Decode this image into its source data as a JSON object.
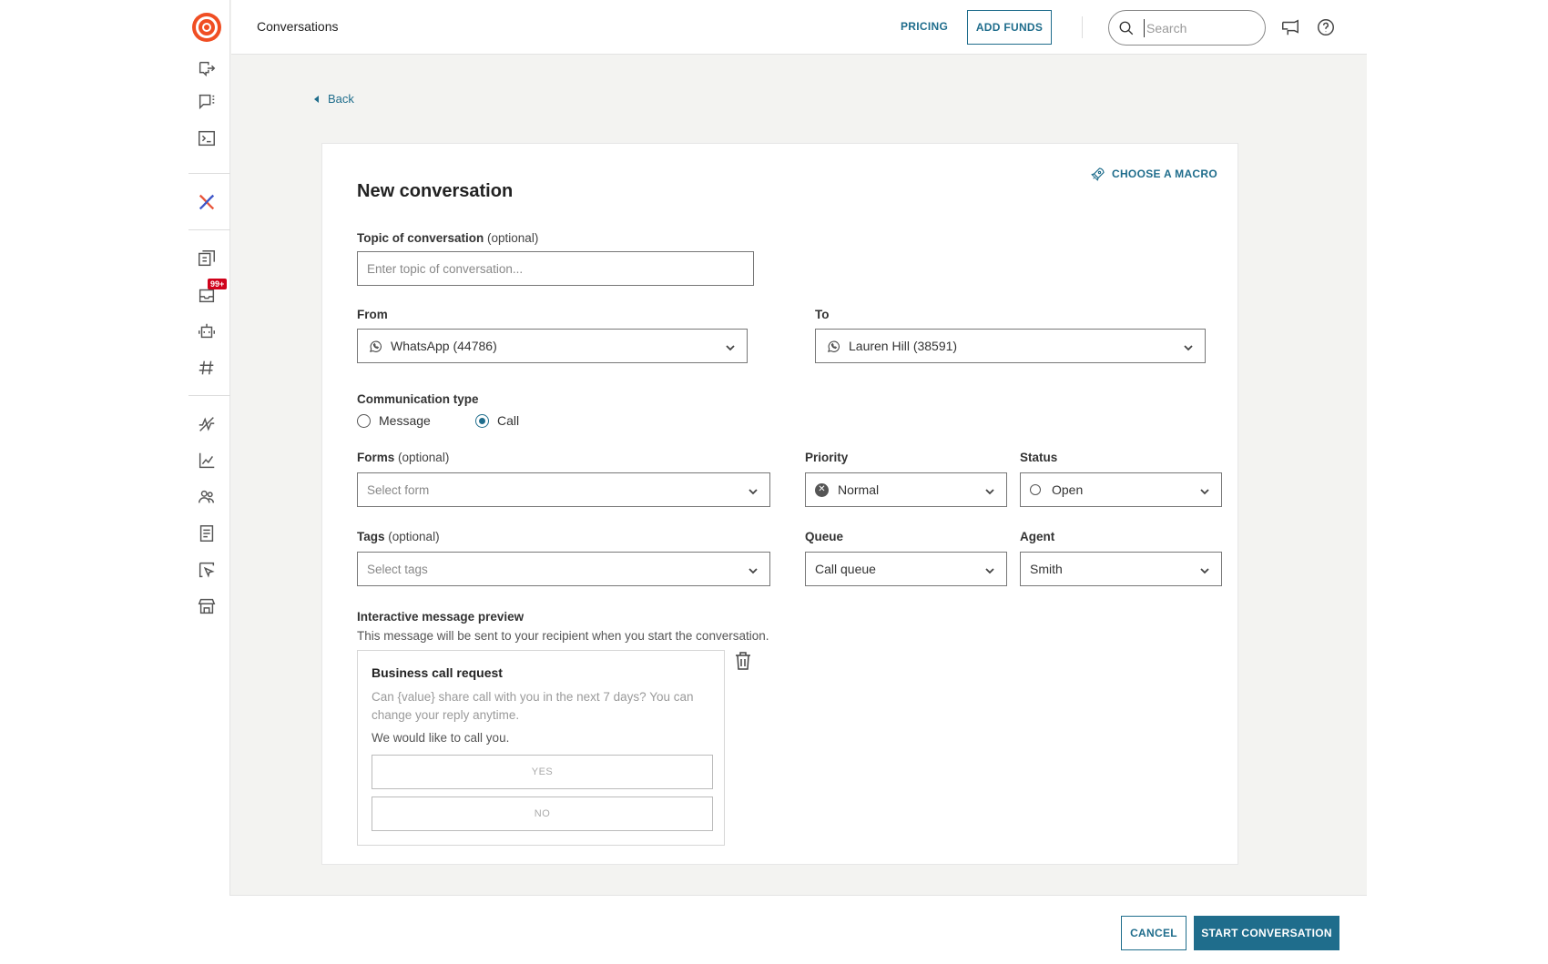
{
  "header": {
    "title": "Conversations",
    "pricing_label": "PRICING",
    "add_funds_label": "ADD FUNDS",
    "search_placeholder": "Search"
  },
  "sidebar": {
    "badge": "99+",
    "icons": [
      "logo-icon",
      "export-icon",
      "chat-list-icon",
      "terminal-icon",
      "x-brand-icon",
      "templates-icon",
      "inbox-icon",
      "robot-icon",
      "hashtag-icon",
      "flows-icon",
      "analytics-icon",
      "people-icon",
      "logs-icon",
      "cursor-icon",
      "store-icon"
    ]
  },
  "nav": {
    "back_label": "Back"
  },
  "form": {
    "title": "New conversation",
    "macro_label": "CHOOSE A MACRO",
    "topic": {
      "label": "Topic of conversation",
      "optional": "(optional)",
      "placeholder": "Enter topic of conversation..."
    },
    "from": {
      "label": "From",
      "value": "WhatsApp (44786)"
    },
    "to": {
      "label": "To",
      "value": "Lauren Hill (38591)"
    },
    "communication": {
      "label": "Communication type",
      "options": [
        "Message",
        "Call"
      ],
      "selected": "Call"
    },
    "forms": {
      "label": "Forms",
      "optional": "(optional)",
      "placeholder": "Select form"
    },
    "priority": {
      "label": "Priority",
      "value": "Normal"
    },
    "status": {
      "label": "Status",
      "value": "Open"
    },
    "tags": {
      "label": "Tags",
      "optional": "(optional)",
      "placeholder": "Select tags"
    },
    "queue": {
      "label": "Queue",
      "value": "Call queue"
    },
    "agent": {
      "label": "Agent",
      "value": "Smith"
    },
    "preview": {
      "label": "Interactive message preview",
      "subtitle": "This message will be sent to your recipient when you start the conversation.",
      "message_title": "Business call request",
      "message_body": "Can {value} share call with you in the next 7 days? You can change your reply anytime.",
      "message_footer": "We would like to call you.",
      "options": [
        "YES",
        "NO"
      ]
    }
  },
  "footer": {
    "cancel_label": "CANCEL",
    "start_label": "START CONVERSATION"
  },
  "colors": {
    "accent": "#1f6d8c",
    "brand": "#f04e23",
    "badge": "#d0021b"
  }
}
